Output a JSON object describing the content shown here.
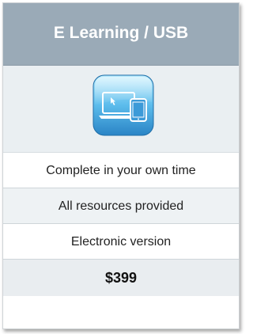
{
  "card": {
    "title": "E Learning / USB",
    "icon": "laptop-tablet-icon",
    "features": [
      "Complete in your own time",
      "All resources provided",
      "Electronic version"
    ],
    "price": "$399",
    "colors": {
      "header_bg": "#9aaab7",
      "header_text": "#ffffff",
      "icon_gradient_top": "#9fe3fb",
      "icon_gradient_bottom": "#2f8ecf",
      "alt_row_bg": "#eef2f4"
    }
  }
}
